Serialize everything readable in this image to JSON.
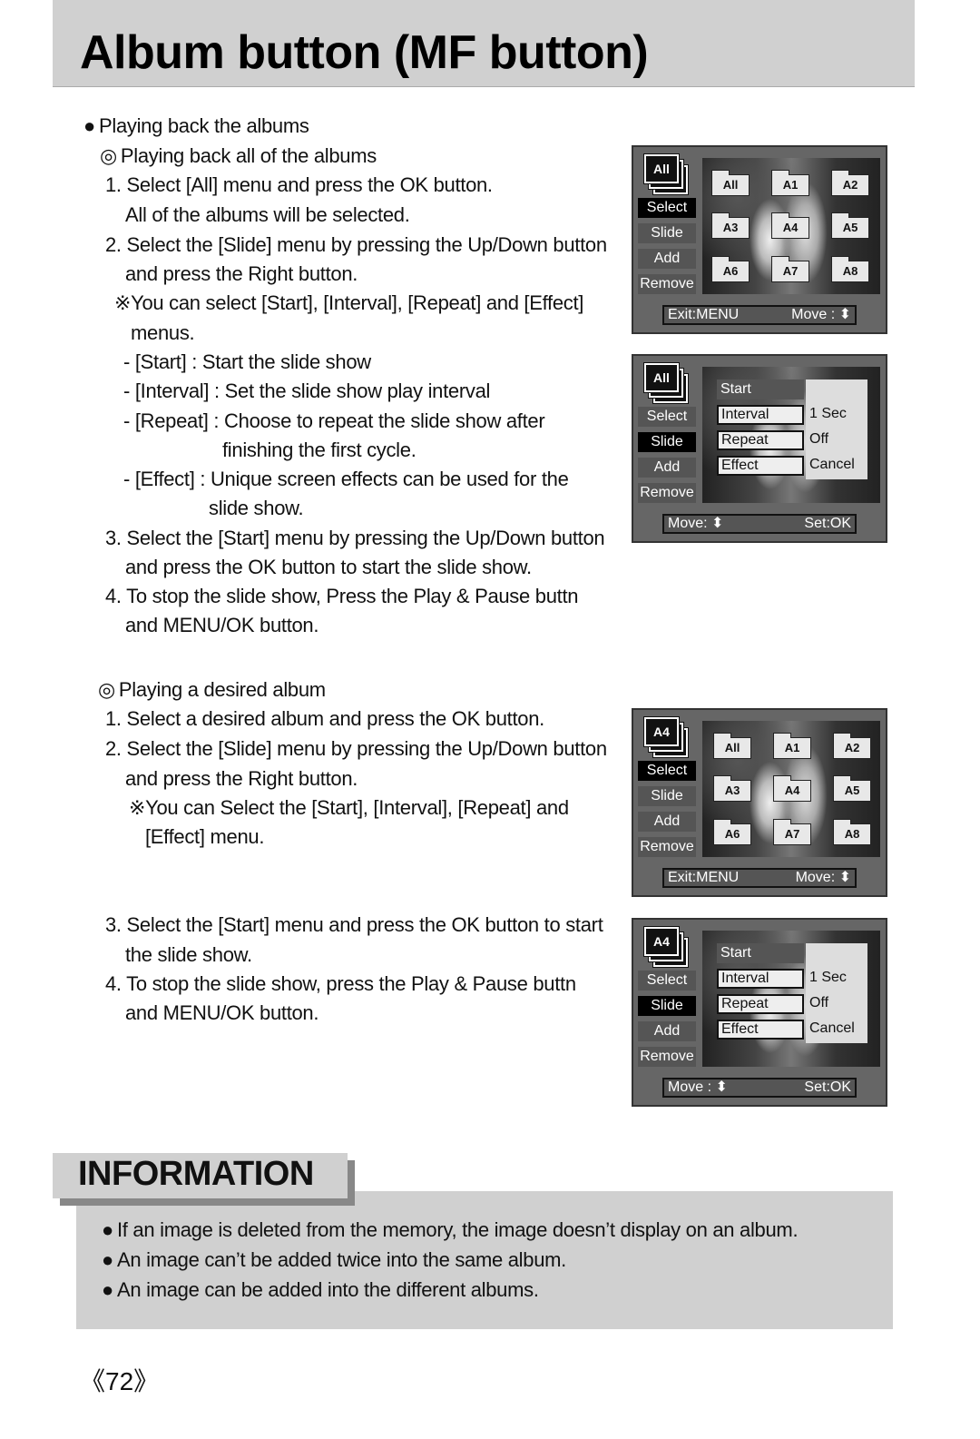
{
  "page_title": "Album button (MF button)",
  "intro": {
    "bullet": "●",
    "heading": "Playing back the albums"
  },
  "section_all": {
    "mark": "◎",
    "heading": "Playing back all of the albums",
    "lines": [
      "1. Select [All] menu and press the OK button.",
      "All of the albums will be selected.",
      "2. Select the [Slide] menu by pressing the Up/Down button",
      "and press the Right button.",
      "※You can select [Start], [Interval], [Repeat] and [Effect]",
      "menus.",
      "- [Start] : Start the slide show",
      "- [Interval] : Set the slide show play interval",
      "- [Repeat] : Choose to repeat the slide show after",
      "finishing the first cycle.",
      "- [Effect] : Unique screen effects can be used for the",
      "slide show.",
      "3. Select the [Start] menu by pressing the Up/Down button",
      "and press the OK button to start the slide show.",
      "4. To stop the slide show, Press the Play & Pause buttn",
      "and MENU/OK button."
    ]
  },
  "section_desired": {
    "mark": "◎",
    "heading": "Playing a desired album",
    "lines": [
      "1. Select a desired album and press the OK button.",
      "2. Select the [Slide] menu by pressing the Up/Down button",
      "and press the Right button.",
      "※You can Select the [Start], [Interval], [Repeat] and",
      "[Effect] menu.",
      "3. Select the [Start] menu and press the OK button to start",
      "the slide show.",
      "4. To stop the slide show, press the Play & Pause buttn",
      "and MENU/OK button."
    ]
  },
  "screens": [
    {
      "album_icon": "All",
      "side_menu": [
        "Select",
        "Slide",
        "Add",
        "Remove"
      ],
      "selected": "Select",
      "folders": [
        "All",
        "A1",
        "A2",
        "A3",
        "A4",
        "A5",
        "A6",
        "A7",
        "A8"
      ],
      "footer_left": "Exit:MENU",
      "footer_right": "Move : ⬍"
    },
    {
      "album_icon": "All",
      "side_menu": [
        "Select",
        "Slide",
        "Add",
        "Remove"
      ],
      "selected": "Slide",
      "submenu": [
        "Start",
        "Interval",
        "Repeat",
        "Effect"
      ],
      "options": [
        "1 Sec",
        "Off",
        "Cancel"
      ],
      "footer_left": "Move: ⬍",
      "footer_right": "Set:OK"
    },
    {
      "album_icon": "A4",
      "side_menu": [
        "Select",
        "Slide",
        "Add",
        "Remove"
      ],
      "selected": "Select",
      "folders": [
        "All",
        "A1",
        "A2",
        "A3",
        "A4",
        "A5",
        "A6",
        "A7",
        "A8"
      ],
      "footer_left": "Exit:MENU",
      "footer_right": "Move: ⬍"
    },
    {
      "album_icon": "A4",
      "side_menu": [
        "Select",
        "Slide",
        "Add",
        "Remove"
      ],
      "selected": "Slide",
      "submenu": [
        "Start",
        "Interval",
        "Repeat",
        "Effect"
      ],
      "options": [
        "1 Sec",
        "Off",
        "Cancel"
      ],
      "footer_left": "Move : ⬍",
      "footer_right": "Set:OK"
    }
  ],
  "information": {
    "title": "INFORMATION",
    "bullet": "●",
    "items": [
      "If an image is deleted from the memory, the image doesn’t display on an album.",
      "An image can’t be added twice into the same album.",
      "An image can be added into the different albums."
    ]
  },
  "page_number": "《72》"
}
